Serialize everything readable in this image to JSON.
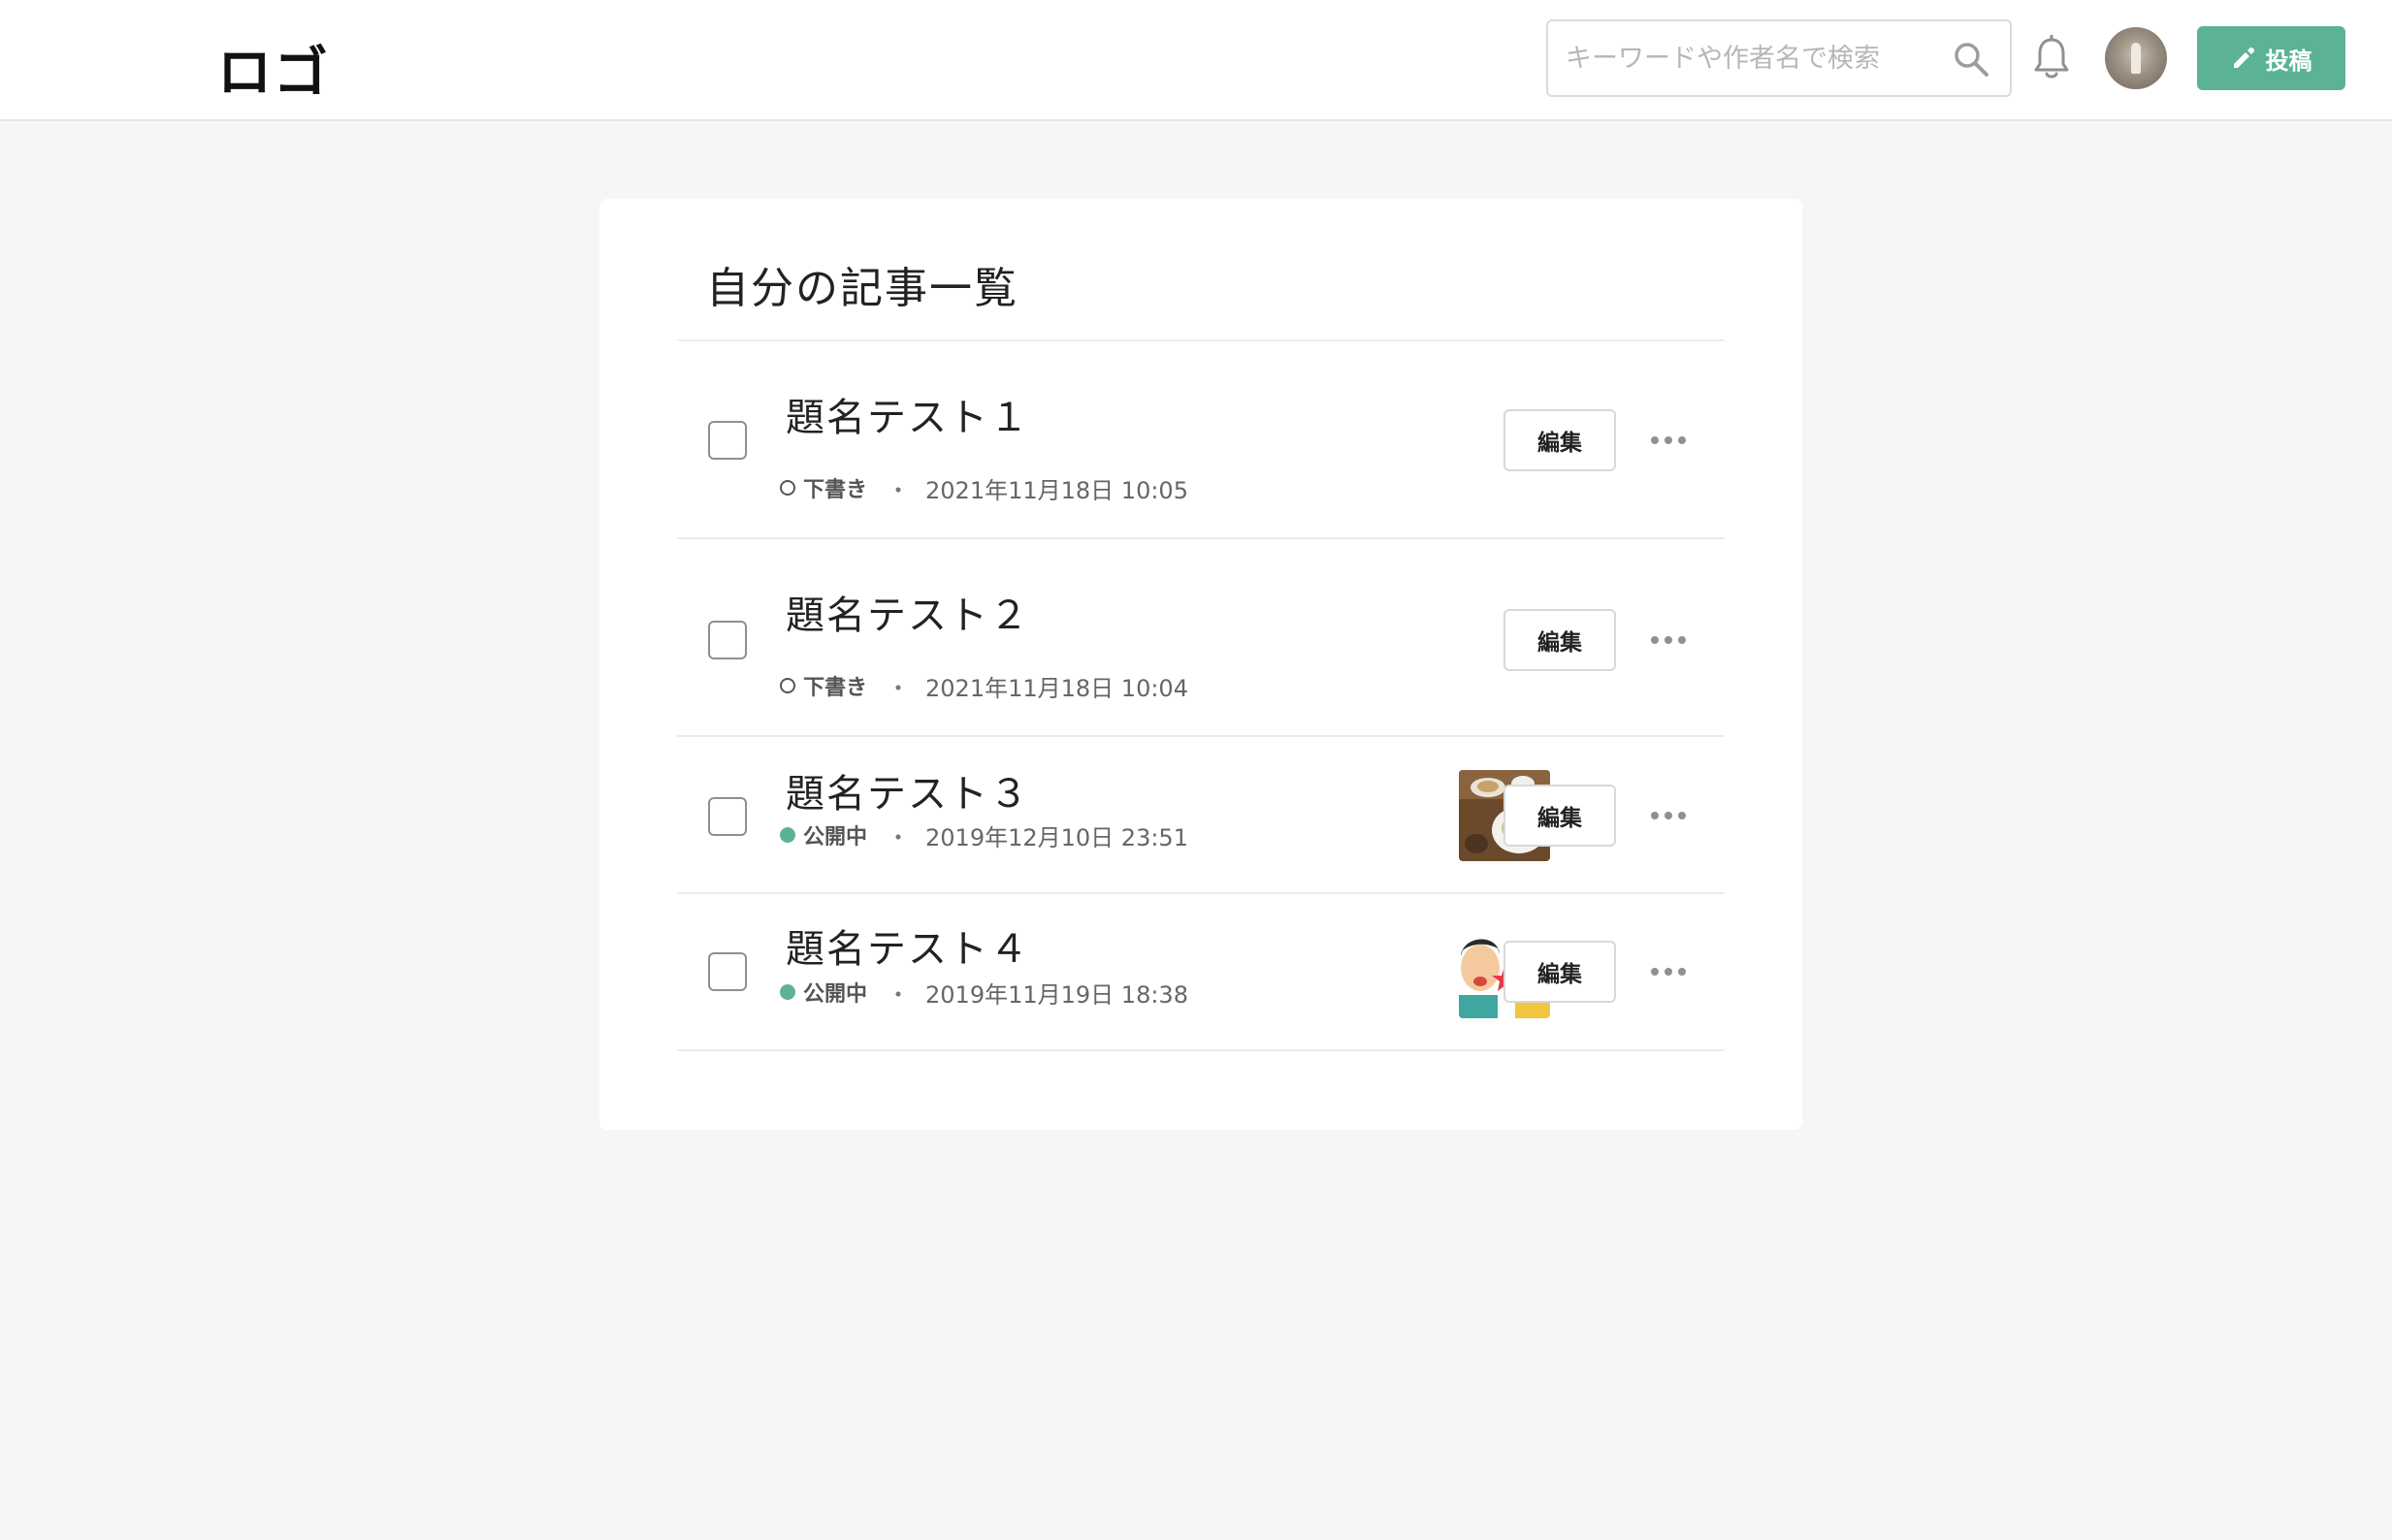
{
  "header": {
    "logo": "ロゴ",
    "search_placeholder": "キーワードや作者名で検索",
    "post_button_label": "投稿",
    "accent_color": "#5bb394"
  },
  "main": {
    "title": "自分の記事一覧",
    "edit_label": "編集",
    "articles": [
      {
        "title": "題名テスト１",
        "status": "下書き",
        "status_type": "draft",
        "date": "2021年11月18日 10:05",
        "thumbnail": null
      },
      {
        "title": "題名テスト２",
        "status": "下書き",
        "status_type": "draft",
        "date": "2021年11月18日 10:04",
        "thumbnail": null
      },
      {
        "title": "題名テスト３",
        "status": "公開中",
        "status_type": "public",
        "date": "2019年12月10日 23:51",
        "thumbnail": "food-photo"
      },
      {
        "title": "題名テスト４",
        "status": "公開中",
        "status_type": "public",
        "date": "2019年11月19日 18:38",
        "thumbnail": "cartoon-illustration"
      }
    ]
  },
  "icons": {
    "search": "search-icon",
    "notification": "bell-icon",
    "post": "pencil-icon",
    "more": "more-horizontal-icon"
  }
}
